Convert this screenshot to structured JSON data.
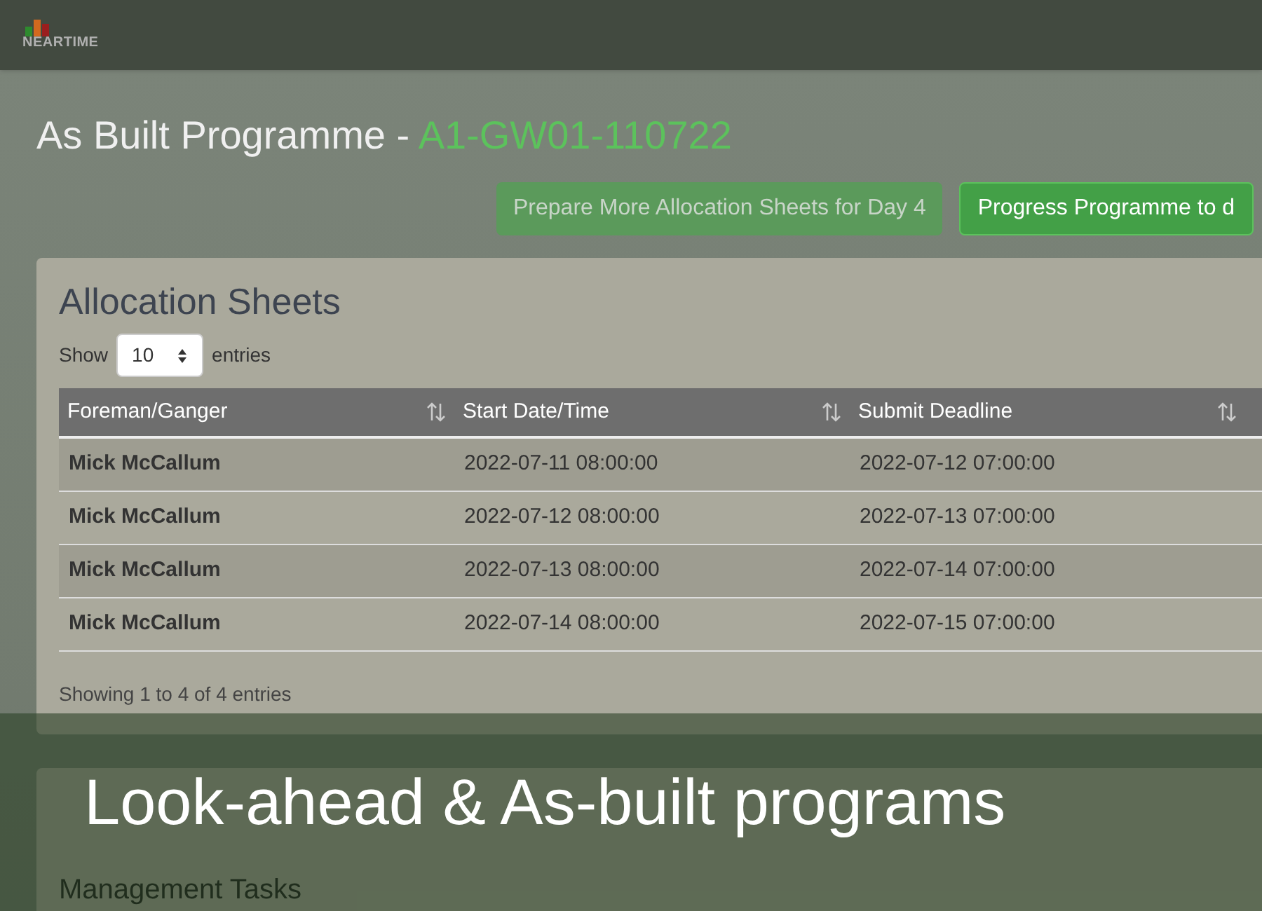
{
  "logo": {
    "text": "NEARTIME"
  },
  "page_title": {
    "text": "As Built Programme - ",
    "code": "A1-GW01-110722"
  },
  "buttons": [
    {
      "label": "Prepare More Allocation Sheets for Day 4",
      "disabled": true
    },
    {
      "label": "Progress Programme to d",
      "disabled": false
    }
  ],
  "allocation_sheets": {
    "title": "Allocation Sheets",
    "show_label": "Show",
    "page_size": "10",
    "entries_label": "entries",
    "columns": [
      "Foreman/Ganger",
      "Start Date/Time",
      "Submit Deadline"
    ],
    "rows": [
      [
        "Mick McCallum",
        "2022-07-11 08:00:00",
        "2022-07-12 07:00:00"
      ],
      [
        "Mick McCallum",
        "2022-07-12 08:00:00",
        "2022-07-13 07:00:00"
      ],
      [
        "Mick McCallum",
        "2022-07-13 08:00:00",
        "2022-07-14 07:00:00"
      ],
      [
        "Mick McCallum",
        "2022-07-14 08:00:00",
        "2022-07-15 07:00:00"
      ]
    ],
    "footer": "Showing 1 to 4 of 4 entries"
  },
  "planned_tasks": {
    "subtitle": "Management Tasks"
  },
  "caption": "Look-ahead & As-built programs"
}
